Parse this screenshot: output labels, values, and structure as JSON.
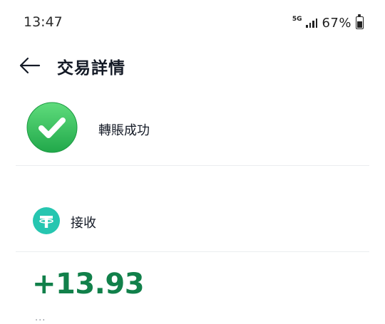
{
  "status_bar": {
    "time": "13:47",
    "network": "5G",
    "battery_percent": "67%",
    "battery_level": 0.67
  },
  "header": {
    "back_icon": "arrow-left-icon",
    "title": "交易詳情"
  },
  "status": {
    "icon": "check-circle-icon",
    "text": "轉賬成功",
    "color": "#34c15c"
  },
  "transaction": {
    "token_icon": "tether-icon",
    "token_color": "#26c6b0",
    "type": "接收",
    "amount": "+13.93",
    "amount_color": "#11804a",
    "more": "..."
  }
}
